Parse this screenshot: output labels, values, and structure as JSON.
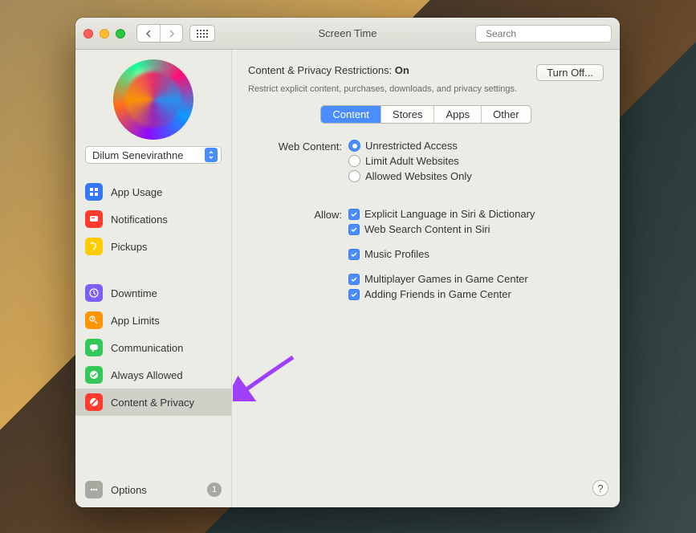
{
  "window": {
    "title": "Screen Time",
    "search_placeholder": "Search"
  },
  "sidebar": {
    "user_name": "Dilum Senevirathne",
    "groups": [
      {
        "items": [
          {
            "label": "App Usage",
            "icon": "app-usage-icon",
            "color": "#3478f6"
          },
          {
            "label": "Notifications",
            "icon": "notifications-icon",
            "color": "#ff3b30"
          },
          {
            "label": "Pickups",
            "icon": "pickups-icon",
            "color": "#ffcc00"
          }
        ]
      },
      {
        "items": [
          {
            "label": "Downtime",
            "icon": "downtime-icon",
            "color": "#7d5ef7"
          },
          {
            "label": "App Limits",
            "icon": "app-limits-icon",
            "color": "#ff9500"
          },
          {
            "label": "Communication",
            "icon": "communication-icon",
            "color": "#34c759"
          },
          {
            "label": "Always Allowed",
            "icon": "always-allowed-icon",
            "color": "#34c759"
          },
          {
            "label": "Content & Privacy",
            "icon": "content-privacy-icon",
            "color": "#ff3b30",
            "selected": true
          }
        ]
      }
    ],
    "options_label": "Options",
    "options_badge": "1"
  },
  "main": {
    "heading_prefix": "Content & Privacy Restrictions: ",
    "heading_state": "On",
    "turn_off_label": "Turn Off...",
    "subtext": "Restrict explicit content, purchases, downloads, and privacy settings.",
    "tabs": [
      "Content",
      "Stores",
      "Apps",
      "Other"
    ],
    "active_tab": "Content",
    "web_content_label": "Web Content:",
    "web_content_options": [
      "Unrestricted Access",
      "Limit Adult Websites",
      "Allowed Websites Only"
    ],
    "web_content_selected": 0,
    "allow_label": "Allow:",
    "allow_groups": [
      [
        "Explicit Language in Siri & Dictionary",
        "Web Search Content in Siri"
      ],
      [
        "Music Profiles"
      ],
      [
        "Multiplayer Games in Game Center",
        "Adding Friends in Game Center"
      ]
    ],
    "help_label": "?"
  }
}
